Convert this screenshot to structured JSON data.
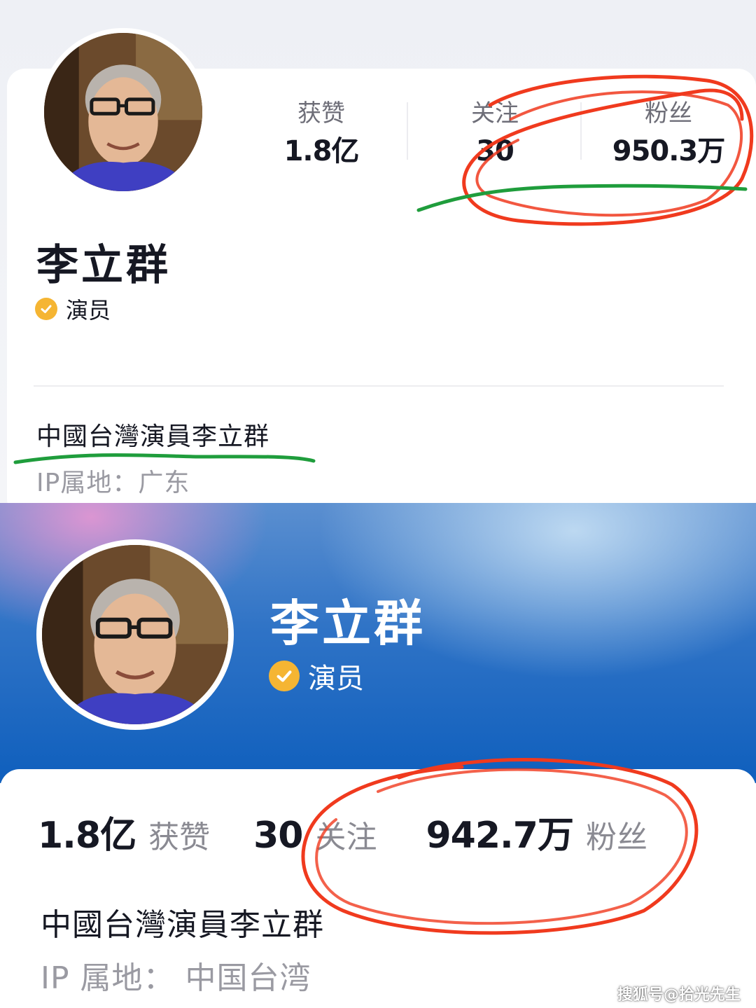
{
  "top_profile": {
    "stats": [
      {
        "label": "获赞",
        "value": "1.8亿"
      },
      {
        "label": "关注",
        "value": "30"
      },
      {
        "label": "粉丝",
        "value": "950.3万"
      }
    ],
    "name": "李立群",
    "verification": "演员",
    "bio": "中國台灣演員李立群",
    "ip_location": "IP属地：广东"
  },
  "bottom_profile": {
    "name": "李立群",
    "verification": "演员",
    "stats": {
      "likes": {
        "value": "1.8亿",
        "label": "获赞"
      },
      "following": {
        "value": "30",
        "label": "关注"
      },
      "followers": {
        "value": "942.7万",
        "label": "粉丝"
      }
    },
    "bio": "中國台灣演員李立群",
    "ip_location": "IP 属地： 中国台湾"
  },
  "watermark": "搜狐号@拾光先生",
  "colors": {
    "verified_badge": "#f5b533",
    "hero_blue": "#0f5fbd",
    "annotation_red": "#f03a1e",
    "annotation_green": "#1f9d3c"
  },
  "icons": {
    "avatar": "portrait-photo",
    "verified": "check-badge-icon"
  }
}
